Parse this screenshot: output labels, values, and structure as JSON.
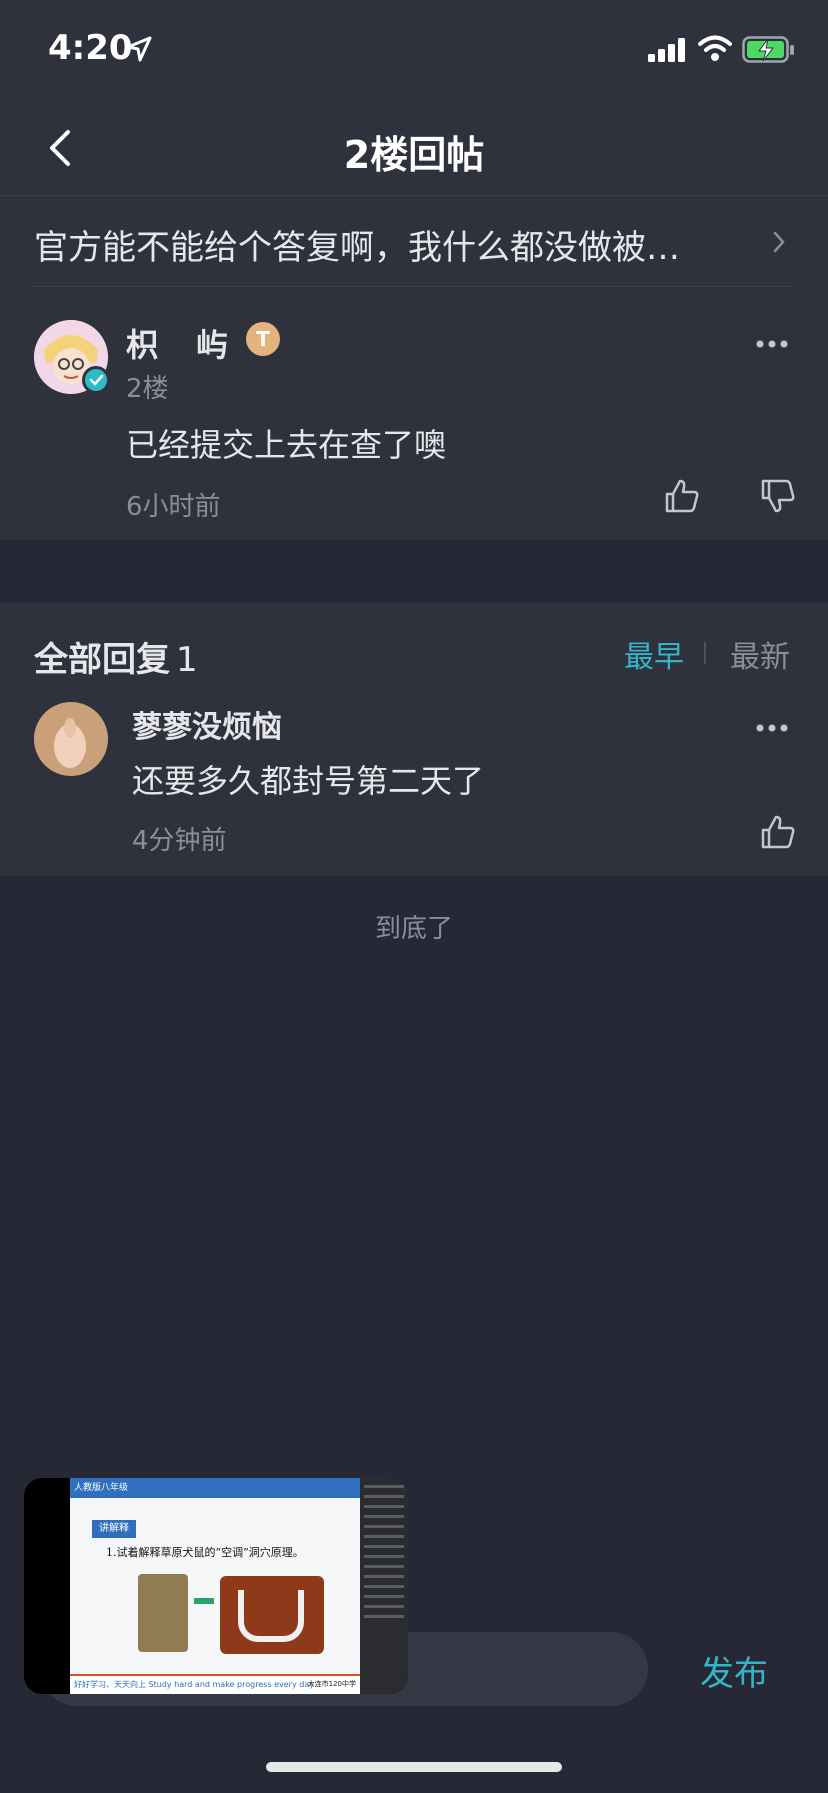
{
  "status_bar": {
    "time": "4:20"
  },
  "nav": {
    "title": "2楼回帖"
  },
  "thread": {
    "title": "官方能不能给个答复啊，我什么都没做被…"
  },
  "post": {
    "author": "枳屿",
    "level_badge": "T",
    "floor": "2楼",
    "content": "已经提交上去在查了噢",
    "time": "6小时前"
  },
  "replies": {
    "header": "全部回复",
    "count": "1",
    "sort_earliest": "最早",
    "sort_latest": "最新",
    "items": [
      {
        "author": "蓼蓼没烦恼",
        "content": "还要多久都封号第二天了",
        "time": "4分钟前"
      }
    ]
  },
  "end_text": "到底了",
  "composer": {
    "publish_label": "发布"
  },
  "pip": {
    "slide_header": "人教版八年级",
    "tag": "讲解释",
    "question": "1.试着解释草原犬鼠的“空调”洞穴原理。",
    "footer_left": "好好学习、天天向上 Study hard and make progress every day",
    "footer_right": "大连市120中学"
  },
  "colors": {
    "background": "#262935",
    "card": "#2f323d",
    "accent": "#37b3c6",
    "muted_text": "#8b8e98"
  }
}
